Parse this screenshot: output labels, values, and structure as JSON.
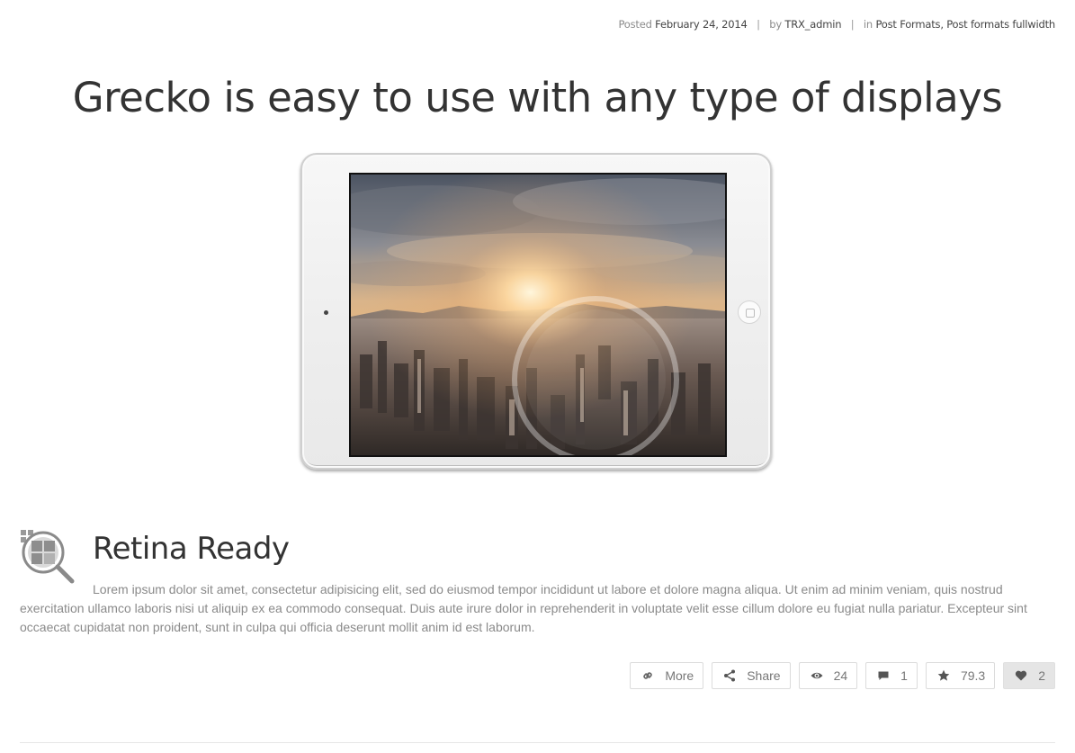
{
  "post_meta": {
    "posted_label": "Posted",
    "date": "February 24, 2014",
    "separator": "|",
    "by_label": "by",
    "author": "TRX_admin",
    "in_label": "in",
    "categories": "Post Formats, Post formats fullwidth"
  },
  "post": {
    "title": "Grecko is easy to use with any type of displays"
  },
  "feature": {
    "icon": "magnifier-grid-icon",
    "title": "Retina Ready",
    "text": "Lorem ipsum dolor sit amet, consectetur adipisicing elit, sed do eiusmod tempor incididunt ut labore et dolore magna aliqua. Ut enim ad minim veniam, quis nostrud exercitation ullamco laboris nisi ut aliquip ex ea commodo consequat. Duis aute irure dolor in reprehenderit in voluptate velit esse cillum dolore eu fugiat nulla pariatur. Excepteur sint occaecat cupidatat non proident, sunt in culpa qui officia deserunt mollit anim id est laborum."
  },
  "actions": {
    "more": {
      "icon": "link-icon",
      "label": "More"
    },
    "share": {
      "icon": "share-icon",
      "label": "Share"
    },
    "views": {
      "icon": "eye-icon",
      "count": "24"
    },
    "comments": {
      "icon": "comment-icon",
      "count": "1"
    },
    "rating": {
      "icon": "star-icon",
      "value": "79.3"
    },
    "likes": {
      "icon": "heart-icon",
      "count": "2"
    }
  }
}
